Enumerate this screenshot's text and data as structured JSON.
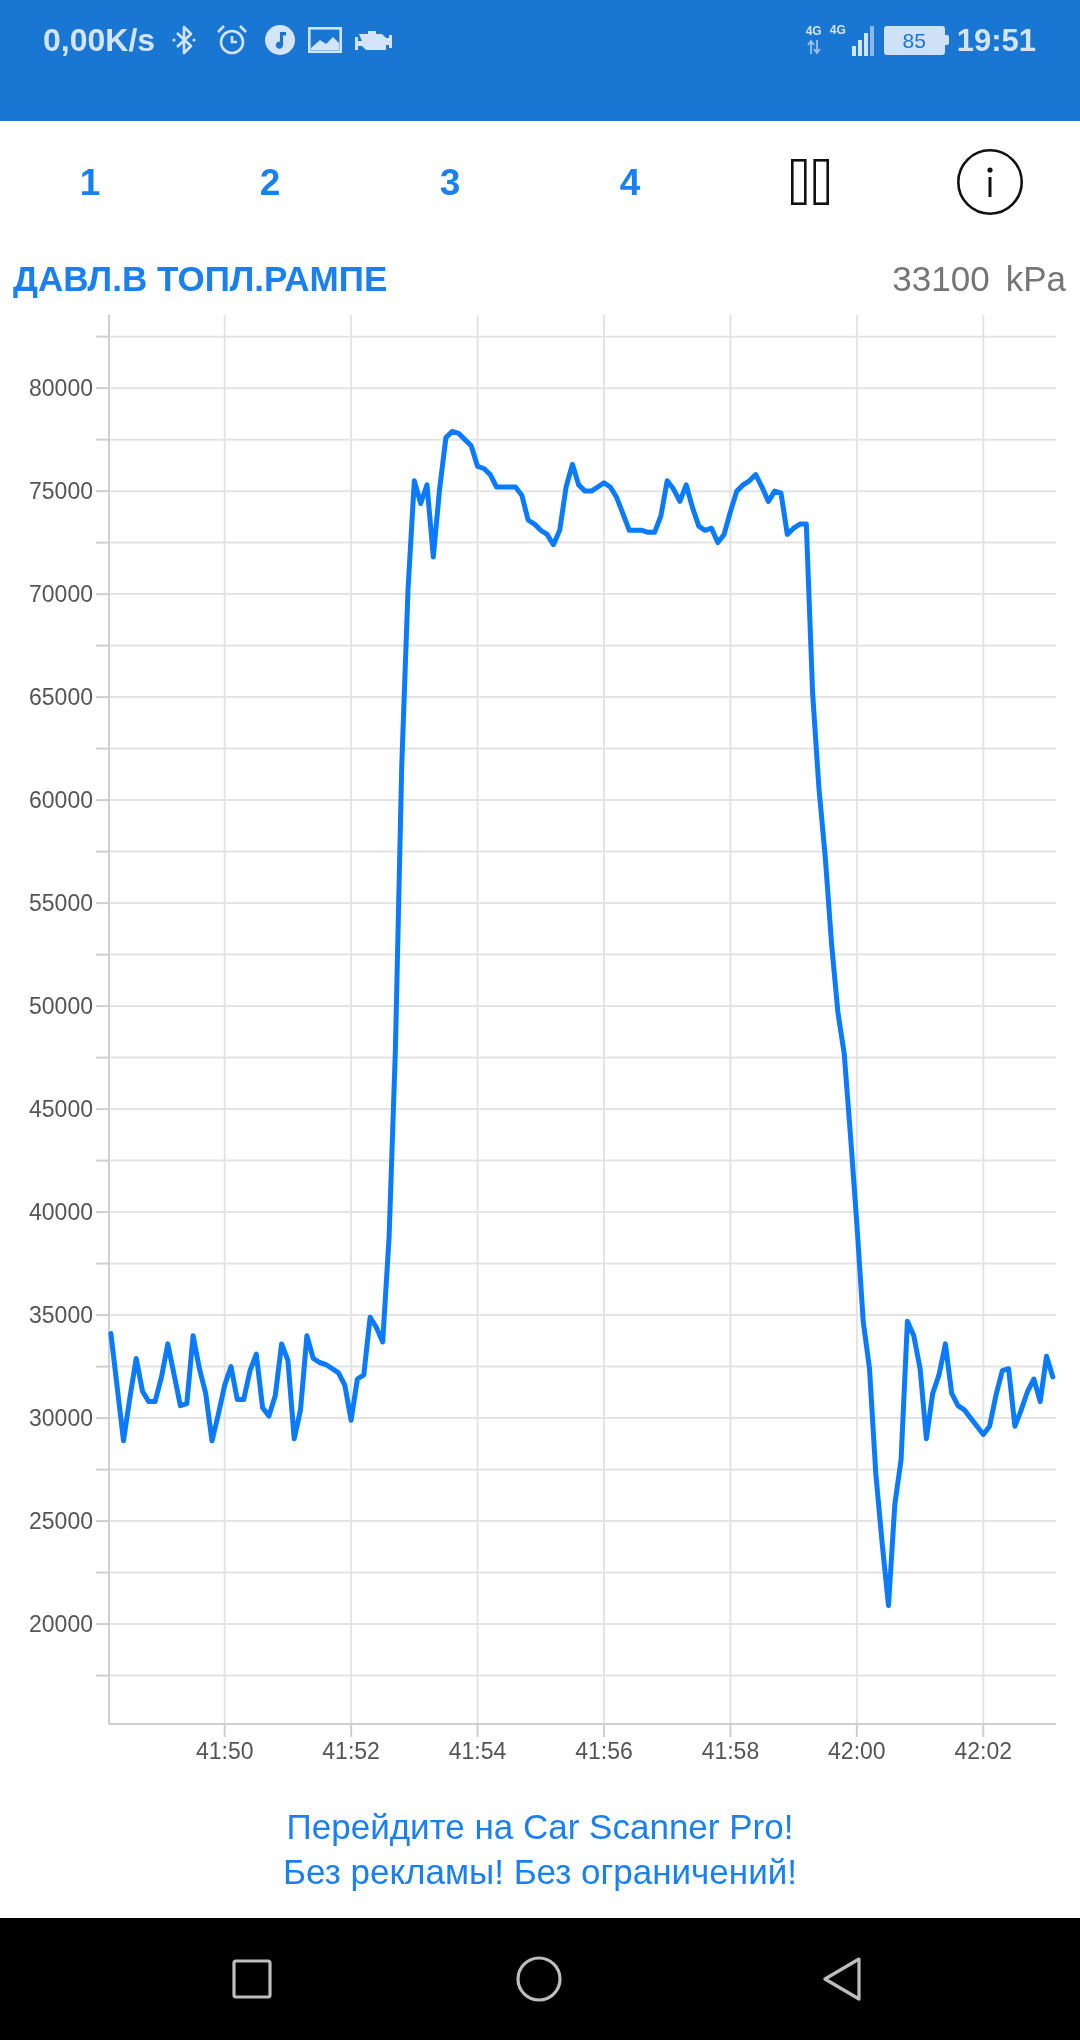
{
  "status_bar": {
    "net_speed": "0,00K/s",
    "network_1": "4G",
    "network_2": "4G",
    "battery": "85",
    "time": "19:51"
  },
  "toolbar": {
    "pages": [
      "1",
      "2",
      "3",
      "4"
    ]
  },
  "sensor": {
    "title": "ДАВЛ.В ТОПЛ.РАМПЕ",
    "value": "33100",
    "unit": "kPa",
    "chart_data": {
      "type": "line",
      "grid": true,
      "ylim": [
        15150,
        83550
      ],
      "yticks": [
        20000,
        25000,
        30000,
        35000,
        40000,
        45000,
        50000,
        55000,
        60000,
        65000,
        70000,
        75000,
        80000
      ],
      "categories": [
        null,
        null,
        null,
        null,
        null,
        null,
        null,
        null,
        null,
        null,
        null,
        null,
        null,
        null,
        null,
        null,
        null,
        null,
        "41:50",
        null,
        null,
        null,
        null,
        null,
        null,
        null,
        null,
        null,
        null,
        null,
        null,
        null,
        null,
        null,
        null,
        null,
        null,
        null,
        "41:52",
        null,
        null,
        null,
        null,
        null,
        null,
        null,
        null,
        null,
        null,
        null,
        null,
        null,
        null,
        null,
        null,
        null,
        null,
        null,
        "41:54",
        null,
        null,
        null,
        null,
        null,
        null,
        null,
        null,
        null,
        null,
        null,
        null,
        null,
        null,
        null,
        null,
        null,
        null,
        null,
        "41:56",
        null,
        null,
        null,
        null,
        null,
        null,
        null,
        null,
        null,
        null,
        null,
        null,
        null,
        null,
        null,
        null,
        null,
        null,
        null,
        "41:58",
        null,
        null,
        null,
        null,
        null,
        null,
        null,
        null,
        null,
        null,
        null,
        null,
        null,
        null,
        null,
        null,
        null,
        null,
        null,
        "42:00",
        null,
        null,
        null,
        null,
        null,
        null,
        null,
        null,
        null,
        null,
        null,
        null,
        null,
        null,
        null,
        null,
        null,
        null,
        null,
        "42:02",
        null,
        null,
        null,
        null,
        null,
        null,
        null,
        null,
        null,
        null,
        null
      ],
      "values": [
        34100,
        31500,
        28900,
        31000,
        32900,
        31300,
        30800,
        30800,
        32000,
        33600,
        32100,
        30600,
        30700,
        34000,
        32400,
        31200,
        28900,
        30200,
        31600,
        32500,
        30900,
        30900,
        32300,
        33100,
        30500,
        30100,
        31100,
        33600,
        32800,
        29000,
        30400,
        34000,
        32900,
        32700,
        32600,
        32400,
        32200,
        31600,
        29900,
        31900,
        32100,
        34900,
        34400,
        33700,
        38800,
        47900,
        61600,
        70200,
        75500,
        74400,
        75300,
        71800,
        75100,
        77600,
        77900,
        77800,
        77500,
        77200,
        76200,
        76100,
        75800,
        75200,
        75200,
        75200,
        75200,
        74800,
        73600,
        73400,
        73100,
        72900,
        72400,
        73100,
        75200,
        76300,
        75300,
        75000,
        75000,
        75200,
        75400,
        75200,
        74700,
        73900,
        73100,
        73100,
        73100,
        73000,
        73000,
        73800,
        75500,
        75100,
        74500,
        75300,
        74200,
        73300,
        73100,
        73200,
        72500,
        72900,
        74000,
        75000,
        75300,
        75500,
        75800,
        75200,
        74500,
        75000,
        74900,
        72900,
        73200,
        73400,
        73400,
        65200,
        60600,
        57200,
        53000,
        49700,
        47700,
        43700,
        39400,
        34700,
        32400,
        27300,
        23900,
        20900,
        25800,
        28000,
        34700,
        34000,
        32400,
        29000,
        31200,
        32100,
        33600,
        31200,
        30600,
        30400,
        30000,
        29600,
        29200,
        29600,
        31100,
        32300,
        32400,
        29600,
        30400,
        31300,
        31900,
        30800,
        33000,
        32000
      ]
    }
  },
  "promo": [
    "Перейдите на Car Scanner Pro!",
    "Без рекламы! Без ограничений!"
  ]
}
